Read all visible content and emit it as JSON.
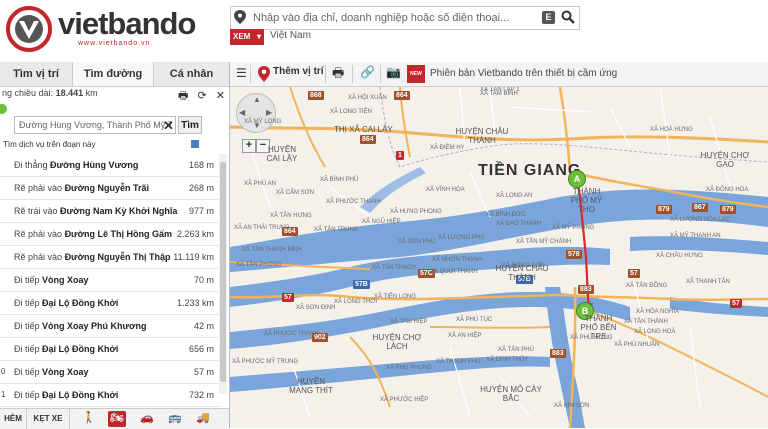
{
  "header": {
    "logo_name": "vietbando",
    "logo_url": "www.vietbando.vn",
    "search_placeholder": "Nhập vào địa chỉ, doanh nghiệp hoặc số điện thoại...",
    "search_e_label": "E",
    "view_button": "XEM",
    "country": "Việt Nam"
  },
  "panel": {
    "tabs": [
      "Tìm vị trí",
      "Tìm đường",
      "Cá nhân"
    ],
    "route_length_label": "ng chiều dài:",
    "route_length_value": "18.441",
    "route_length_unit": "km",
    "destination_value": "Đường Hùng Vương, Thành Phố Mỹ T",
    "find_button": "Tìm",
    "services_label": "Tìm dịch vụ trên đoạn này",
    "steps": [
      {
        "action": "Đi thẳng",
        "street": "Đường Hùng Vương",
        "distance": "168 m"
      },
      {
        "action": "Rẽ phải vào",
        "street": "Đường Nguyễn Trãi",
        "distance": "268 m"
      },
      {
        "action": "Rẽ trái vào",
        "street": "Đường Nam Kỳ Khởi Nghĩa",
        "distance": "977 m"
      },
      {
        "action": "Rẽ phải vào",
        "street": "Đường Lê Thị Hồng Gấm",
        "distance": "2.263 km"
      },
      {
        "action": "Rẽ phải vào",
        "street": "Đường Nguyễn Thị Thập",
        "distance": "11.119 km"
      },
      {
        "action": "Đi tiếp",
        "street": "Vòng Xoay",
        "distance": "70 m"
      },
      {
        "action": "Đi tiếp",
        "street": "Đại Lộ Đồng Khởi",
        "distance": "1.233 km"
      },
      {
        "action": "Đi tiếp",
        "street": "Vòng Xoay Phú Khương",
        "distance": "42 m"
      },
      {
        "action": "Đi tiếp",
        "street": "Đại Lộ Đồng Khởi",
        "distance": "656 m"
      },
      {
        "action": "Đi tiếp",
        "street": "Vòng Xoay",
        "distance": "57 m",
        "index": "0"
      },
      {
        "action": "Đi tiếp",
        "street": "Đại Lộ Đồng Khởi",
        "distance": "732 m",
        "index": "1"
      }
    ],
    "bottom_tabs": [
      "HẺM",
      "KẸT XE"
    ]
  },
  "toolbar": {
    "add_location": "Thêm vị trí",
    "new_badge": "NEW",
    "promo": "Phiên bản Vietbando trên thiết bị cầm ứng"
  },
  "map": {
    "province": "TIỀN GIANG",
    "marker_a": "A",
    "marker_b": "B",
    "road_shields": [
      "868",
      "864",
      "864",
      "1",
      "879",
      "867",
      "879",
      "864",
      "57C",
      "57B",
      "57B",
      "578",
      "883",
      "57",
      "57",
      "902",
      "883",
      "57"
    ],
    "districts": [
      "HUYỆN CHÂU THÀNH",
      "HUYỆN CAI LẬY",
      "THỊ XÃ CAI LẬY",
      "HUYỆN CHỢ GẠO",
      "HUYỆN CHÂU THÀNH",
      "HUYỆN CHỢ LÁCH",
      "HUYỆN MANG THÍT",
      "HUYỆN MỎ CÀY BẮC",
      "THÀNH PHỐ MỸ THO",
      "THÀNH PHỐ BẾN TRE"
    ],
    "places": [
      "XÃ TAM BÌNH",
      "XÃ HỘI XUÂN",
      "XÃ TÂN LẬP 1",
      "XÃ LONG TIÊN",
      "XÃ MỸ LONG",
      "XÃ PHÚ AN",
      "XÃ CẨM SƠN",
      "XÃ BÌNH PHÚ",
      "XÃ HOÀ HƯNG",
      "XÃ NGŨ HIỆP",
      "XÃ TÂN HƯNG",
      "XÃ AN THÁI TRUNG",
      "XÃ TÂN PHONG",
      "XÃ SƠN ĐỊNH",
      "XÃ LONG HOÀ",
      "XÃ HÒA NGHĨA",
      "XÃ QUỚI THÀNH",
      "XÃ PHÚ TÚC",
      "XÃ TÂN THẠCH",
      "XÃ LONG AN",
      "XÃ PHƯỚC THẠNH",
      "XÃ TIÊN LONG",
      "XÃ AN HIỆP",
      "XÃ PHÚ NHUẬN",
      "XÃ TAM HIỆP",
      "XÃ THẠNH PHÚ",
      "XÃ TÂN PHÚ",
      "XÃ TÂN MỸ CHÁNH",
      "XÃ BÌNH ĐỨC",
      "XÃ TÂN THÀNH",
      "XÃ MỸ PHONG",
      "XÃ ĐẠO THẠNH",
      "XÃ HƯNG PHONG",
      "XÃ LƯƠNG PHÚ",
      "XÃ VĨNH HÒA",
      "XÃ NHƠN THẠNH",
      "XÃ PHÚ HƯNG",
      "XÃ SƠN PHÚ",
      "XÃ PHÚ PHỤNG",
      "XÃ PHƯỚC MỸ TRUNG",
      "XÃ TÂN TRUNG",
      "XÃ ĐỊNH THỦY",
      "XÃ PHƯỚC HIỆP",
      "XÃ TÂN THÀNH BÌNH",
      "XÃ CHÂU HƯNG",
      "XÃ THANH TÂN",
      "XÃ LONG THỚI",
      "XÃ ĐIỀM HY",
      "XÃ ĐÔNG HÒA",
      "XÃ LƯƠNG HÒA LẠC",
      "XÃ MỸ THẠNH AN",
      "XÃ PHƯỚC THẠNH",
      "XÃ KIM SƠN",
      "XÃ ĐỒNG SƠN",
      "XÃ TÂN ĐỒNG"
    ]
  }
}
